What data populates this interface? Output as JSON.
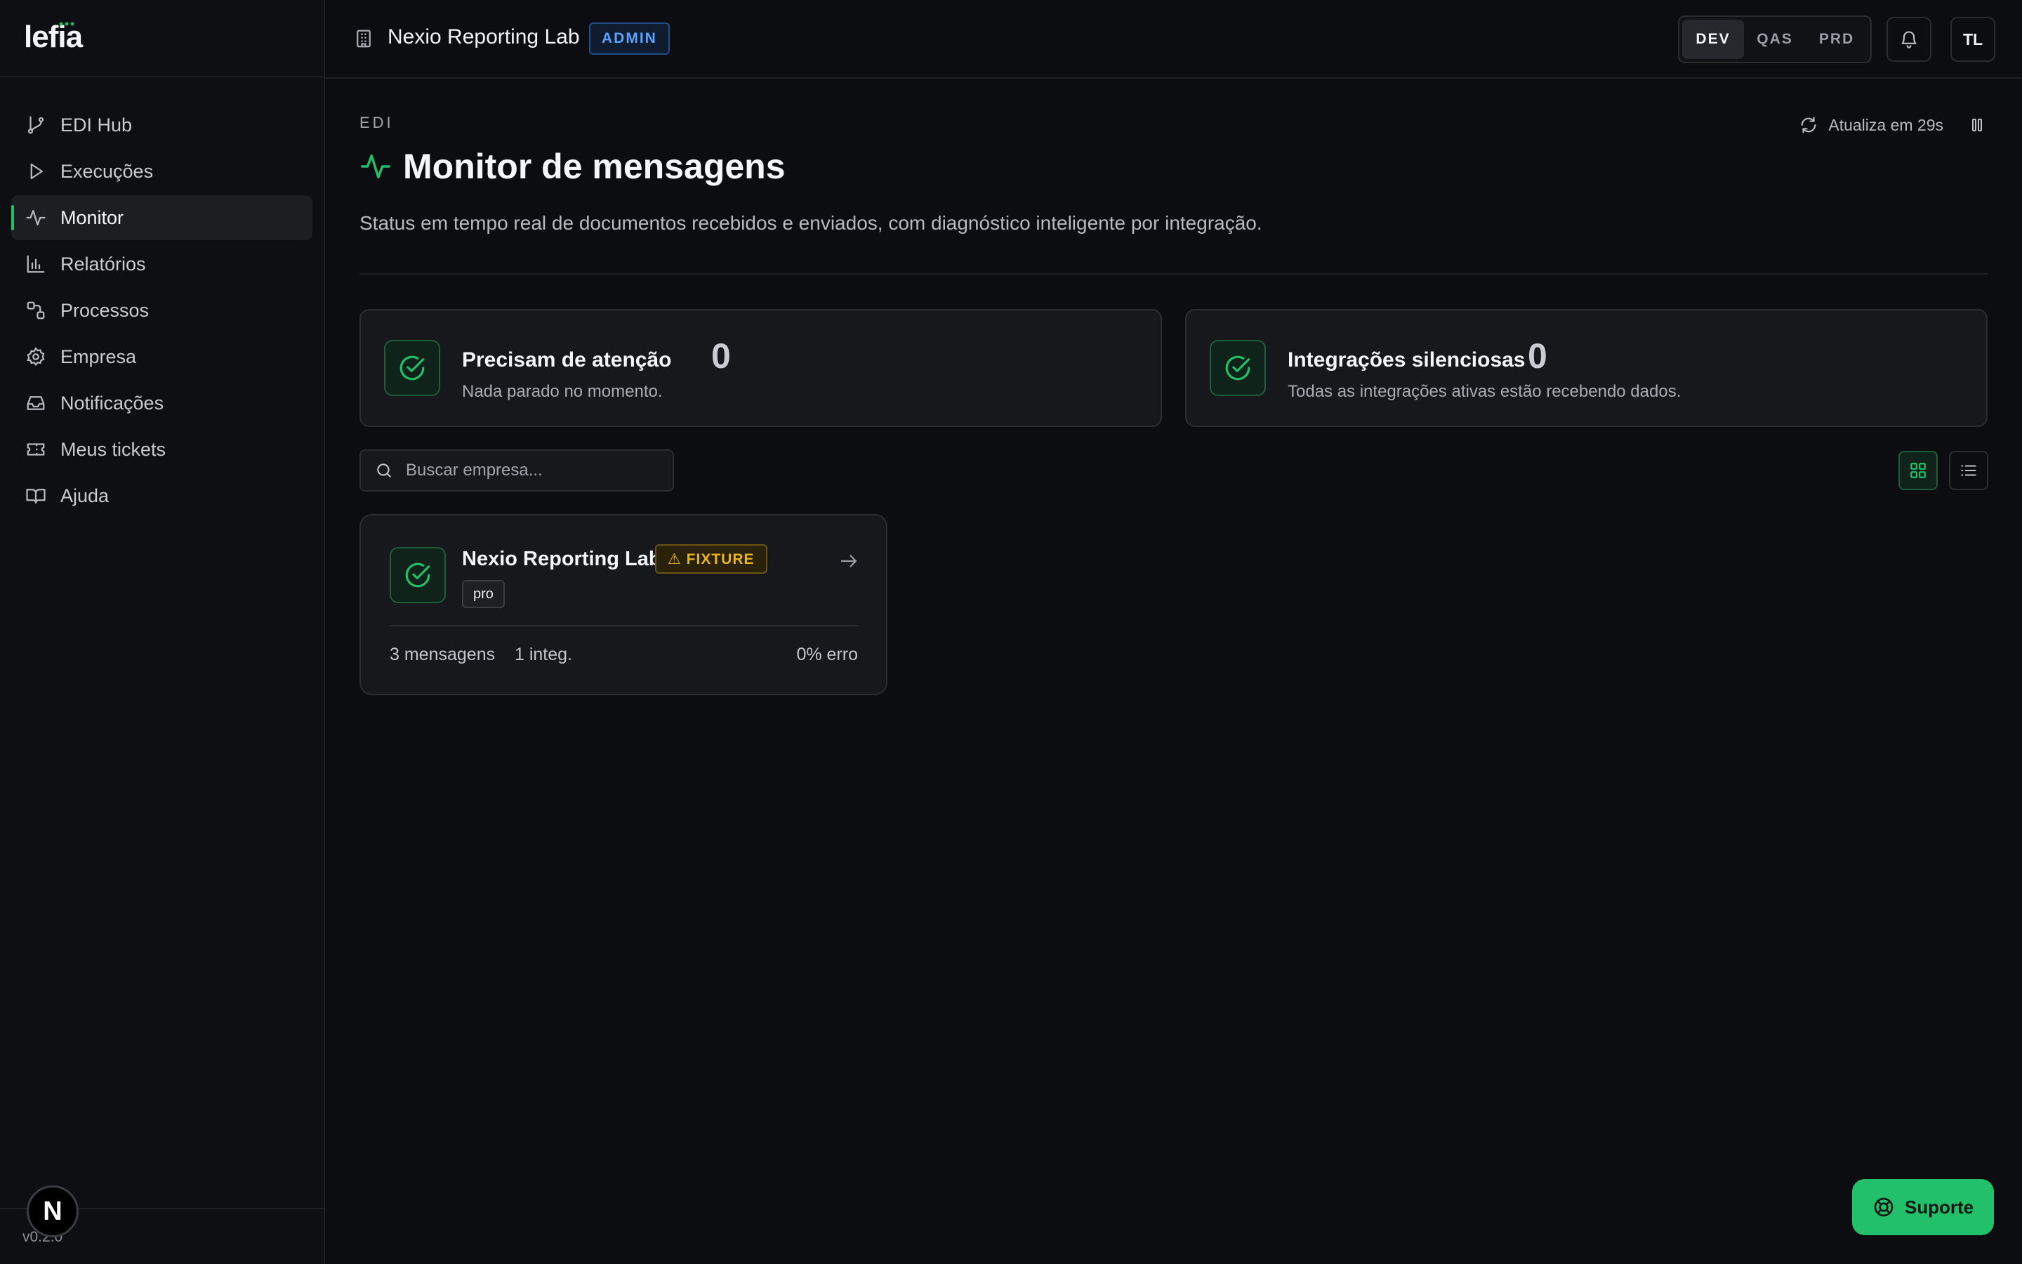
{
  "app": {
    "logo": "lefia",
    "version": "v0.2.0",
    "n_badge": "N"
  },
  "colors": {
    "accent": "#22c06a",
    "admin": "#5aa2ff",
    "warning": "#e8b320",
    "background": "#0c0d10"
  },
  "sidebar": {
    "items": [
      {
        "label": "EDI Hub",
        "icon": "git-branch-icon",
        "active": false
      },
      {
        "label": "Execuções",
        "icon": "play-icon",
        "active": false
      },
      {
        "label": "Monitor",
        "icon": "activity-icon",
        "active": true
      },
      {
        "label": "Relatórios",
        "icon": "bar-chart-icon",
        "active": false
      },
      {
        "label": "Processos",
        "icon": "workflow-icon",
        "active": false
      },
      {
        "label": "Empresa",
        "icon": "gear-icon",
        "active": false
      },
      {
        "label": "Notificações",
        "icon": "inbox-icon",
        "active": false
      },
      {
        "label": "Meus tickets",
        "icon": "ticket-icon",
        "active": false
      },
      {
        "label": "Ajuda",
        "icon": "book-icon",
        "active": false
      }
    ]
  },
  "topbar": {
    "org_name": "Nexio Reporting Lab",
    "role_badge": "ADMIN",
    "environments": [
      {
        "label": "DEV",
        "active": true
      },
      {
        "label": "QAS",
        "active": false
      },
      {
        "label": "PRD",
        "active": false
      }
    ],
    "avatar_initials": "TL"
  },
  "page": {
    "eyebrow": "EDI",
    "title": "Monitor de mensagens",
    "subtitle": "Status em tempo real de documentos recebidos e enviados, com diagnóstico inteligente por integração.",
    "refresh_text": "Atualiza em 29s"
  },
  "stats": [
    {
      "label": "Precisam de atenção",
      "value": "0",
      "description": "Nada parado no momento."
    },
    {
      "label": "Integrações silenciosas",
      "value": "0",
      "description": "Todas as integrações ativas estão recebendo dados."
    }
  ],
  "search": {
    "placeholder": "Buscar empresa..."
  },
  "view_mode": "grid",
  "companies": [
    {
      "name": "Nexio Reporting Lab",
      "badge": "⚠ FIXTURE",
      "plan": "pro",
      "messages": "3 mensagens",
      "integrations": "1 integ.",
      "error_rate": "0% erro"
    }
  ],
  "support": {
    "label": "Suporte"
  }
}
